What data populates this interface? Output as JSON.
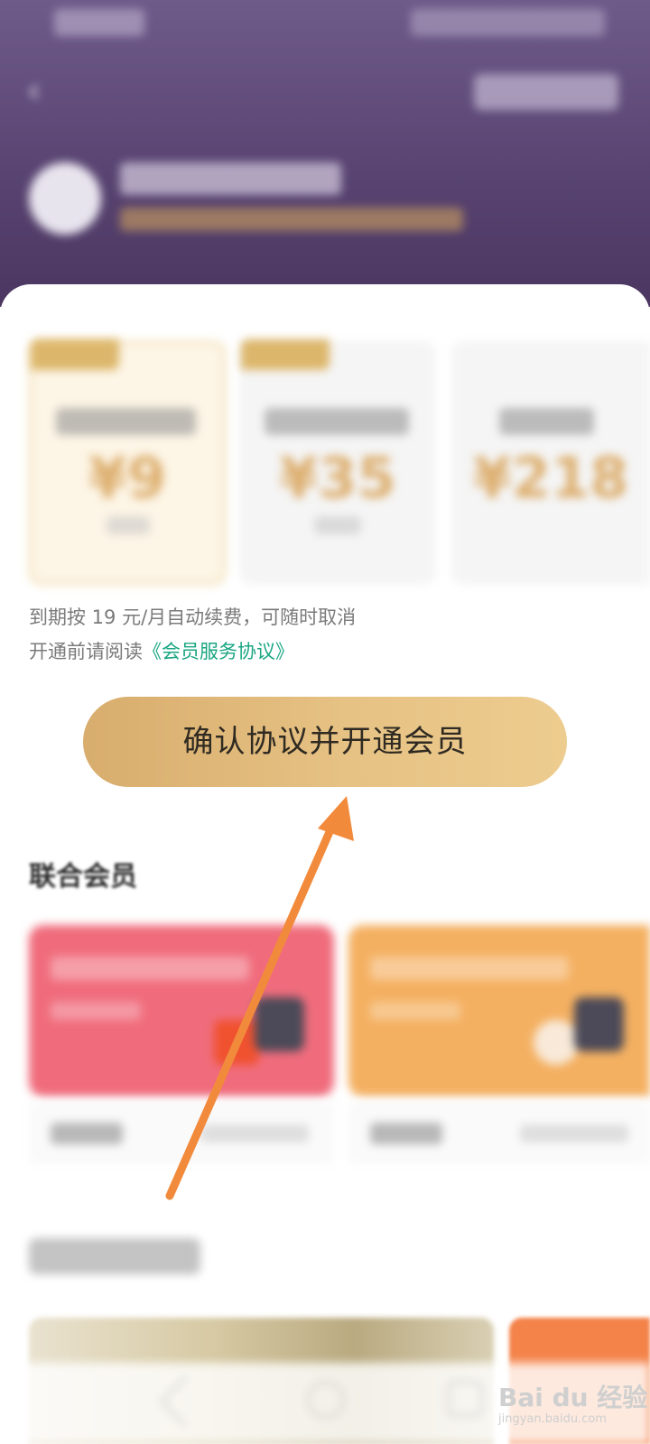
{
  "header": {
    "back_icon": "chevron-left-icon"
  },
  "plans": [
    {
      "price": "¥9",
      "selected": true
    },
    {
      "price": "¥35",
      "selected": false
    },
    {
      "price": "¥218",
      "selected": false
    }
  ],
  "notes": {
    "renewal": "到期按 19 元/月自动续费，可随时取消",
    "agreement_prefix": "开通前请阅读",
    "agreement_link": "《会员服务协议》"
  },
  "confirm_button": {
    "label": "确认协议并开通会员"
  },
  "union": {
    "title": "联合会员"
  },
  "watermark": {
    "main": "Bai du 经验",
    "url": "jingyan.baidu.com"
  },
  "colors": {
    "header_purple": "#5d4876",
    "gold_button": "#e6c284",
    "link_green": "#1aa683",
    "card_red": "#f06c7c",
    "card_orange": "#f4b061",
    "arrow_orange": "#f28a3c"
  }
}
